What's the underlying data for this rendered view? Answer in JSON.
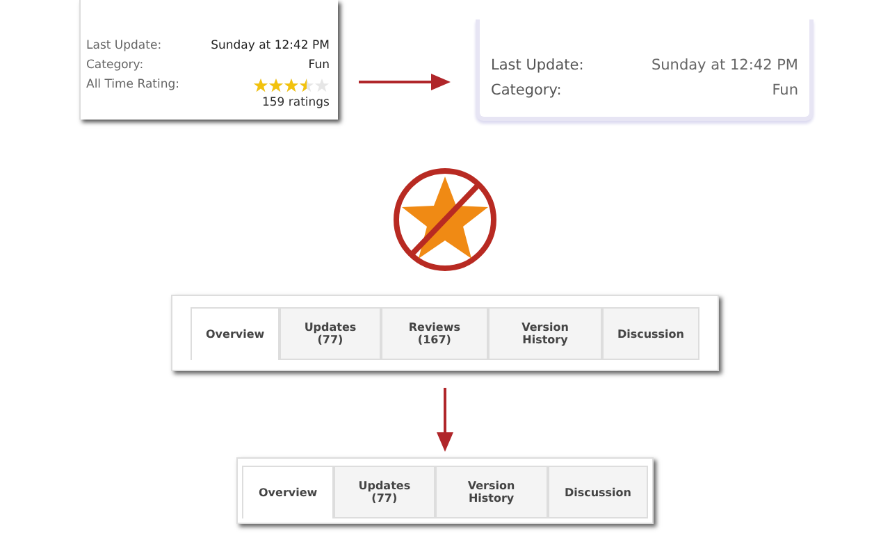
{
  "before_panel": {
    "rows": [
      {
        "label": "Last Update:",
        "value": "Sunday at 12:42 PM"
      },
      {
        "label": "Category:",
        "value": "Fun"
      }
    ],
    "rating": {
      "label": "All Time Rating:",
      "stars": 3.5,
      "count": "159 ratings"
    }
  },
  "after_panel": {
    "rows": [
      {
        "label": "Last Update:",
        "value": "Sunday at 12:42 PM"
      },
      {
        "label": "Category:",
        "value": "Fun"
      }
    ]
  },
  "tabs_before": [
    {
      "label": "Overview",
      "selected": true
    },
    {
      "label": "Updates (77)",
      "selected": false
    },
    {
      "label": "Reviews (167)",
      "selected": false
    },
    {
      "label": "Version History",
      "selected": false
    },
    {
      "label": "Discussion",
      "selected": false
    }
  ],
  "tabs_after": [
    {
      "label": "Overview",
      "selected": true
    },
    {
      "label": "Updates (77)",
      "selected": false
    },
    {
      "label": "Version History",
      "selected": false
    },
    {
      "label": "Discussion",
      "selected": false
    }
  ]
}
